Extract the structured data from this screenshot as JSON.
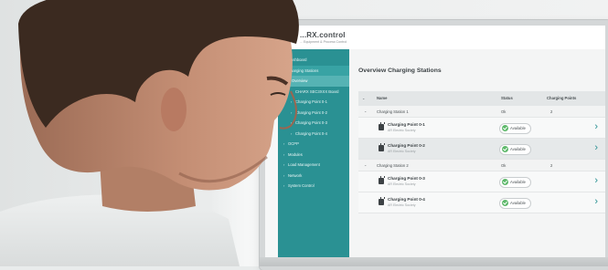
{
  "app": {
    "logo": "...RX.control",
    "logo_sub": "... Equipment & Process Control"
  },
  "sidebar": {
    "items": [
      {
        "label": "Dashboard",
        "caret": "▾"
      },
      {
        "label": "Charging Stations",
        "caret": "▾"
      },
      {
        "label": "Overview",
        "caret": "▾"
      },
      {
        "label": "CHARX SEC3XXX Board",
        "caret": "›"
      },
      {
        "label": "Charging Point 0-1",
        "caret": "›"
      },
      {
        "label": "Charging Point 0-2",
        "caret": "›"
      },
      {
        "label": "Charging Point 0-3",
        "caret": "›"
      },
      {
        "label": "Charging Point 0-4",
        "caret": "›"
      },
      {
        "label": "OCPP",
        "caret": "›"
      },
      {
        "label": "Modules",
        "caret": "›"
      },
      {
        "label": "Load Management",
        "caret": "›"
      },
      {
        "label": "Network",
        "caret": "›"
      },
      {
        "label": "System Control",
        "caret": "›"
      }
    ]
  },
  "main": {
    "title": "Overview Charging Stations",
    "columns": {
      "name": "Name",
      "status": "Status",
      "charging_points": "Charging Points"
    },
    "stations": [
      {
        "name": "Charging Station 1",
        "status": "Ok",
        "count": "2",
        "points": [
          {
            "name": "Charging Point 0-1",
            "sub": "AR Electric Society",
            "status": "Available"
          },
          {
            "name": "Charging Point 0-2",
            "sub": "AR Electric Society",
            "status": "Available"
          }
        ]
      },
      {
        "name": "Charging Station 2",
        "status": "Ok",
        "count": "2",
        "points": [
          {
            "name": "Charging Point 0-3",
            "sub": "AR Electric Society",
            "status": "Available"
          },
          {
            "name": "Charging Point 0-4",
            "sub": "AR Electric Society",
            "status": "Available"
          }
        ]
      }
    ]
  },
  "colors": {
    "accent": "#2a9193",
    "status_ok": "#5db86a"
  }
}
